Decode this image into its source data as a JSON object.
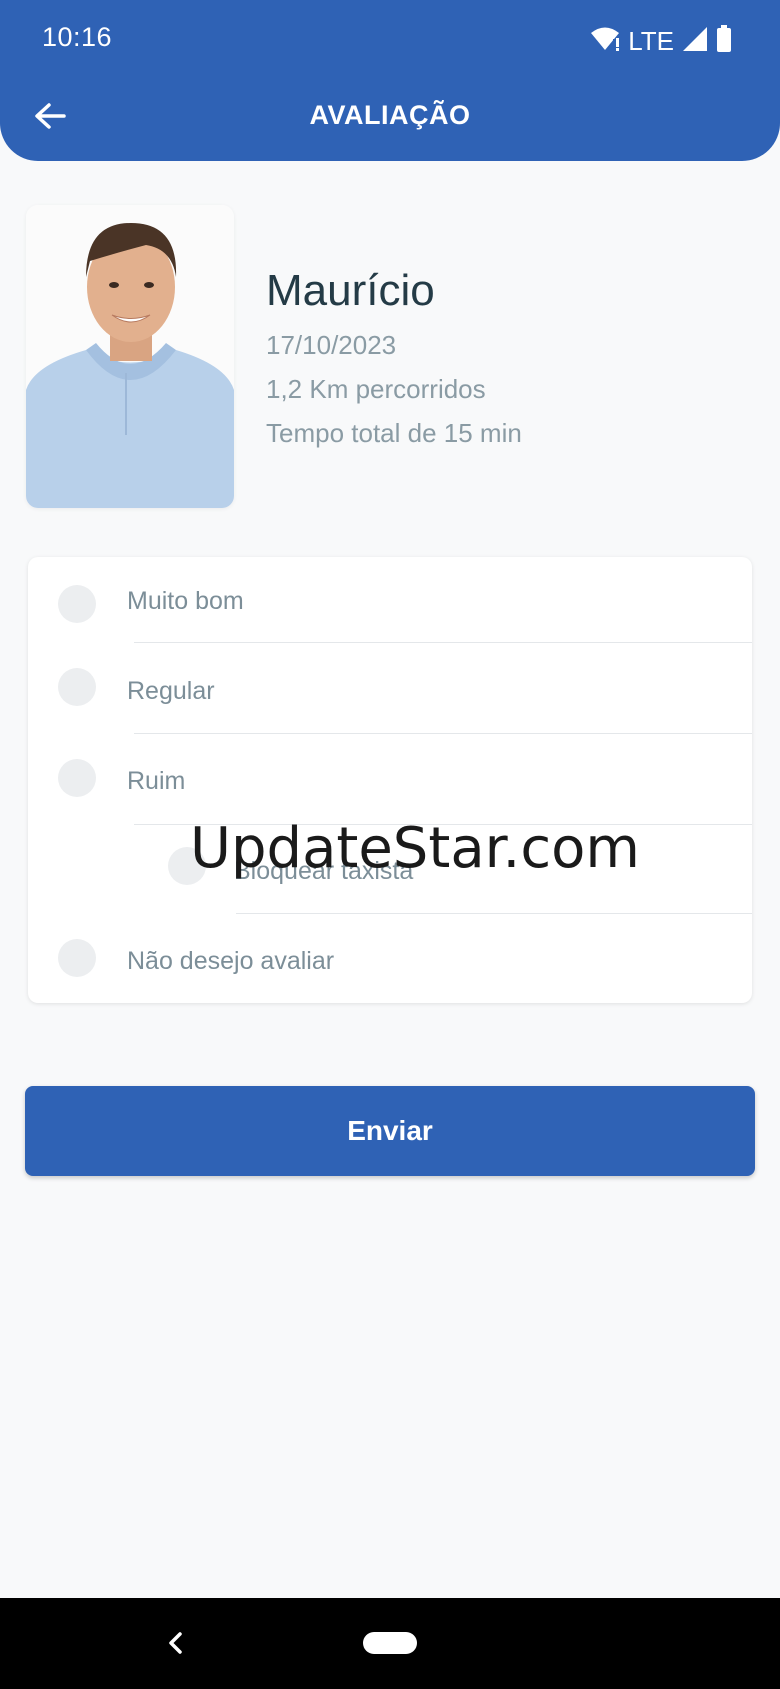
{
  "status_bar": {
    "time": "10:16",
    "network": "LTE",
    "icons": [
      "wifi-icon",
      "signal-icon",
      "battery-icon"
    ]
  },
  "header": {
    "title": "AVALIAÇÃO",
    "back_icon": "arrow-left-icon"
  },
  "driver": {
    "name": "Maurício",
    "date": "17/10/2023",
    "distance": "1,2 Km percorridos",
    "duration": "Tempo total de 15 min"
  },
  "options": [
    {
      "label": "Muito bom"
    },
    {
      "label": "Regular"
    },
    {
      "label": "Ruim"
    },
    {
      "label": "Bloquear taxista"
    },
    {
      "label": "Não desejo avaliar"
    }
  ],
  "submit": {
    "label": "Enviar"
  },
  "watermark": "UpdateStar.com",
  "colors": {
    "primary": "#2f62b5",
    "background": "#f8f9fa",
    "text_dark": "#243b46",
    "text_muted": "#8a9ba4"
  }
}
